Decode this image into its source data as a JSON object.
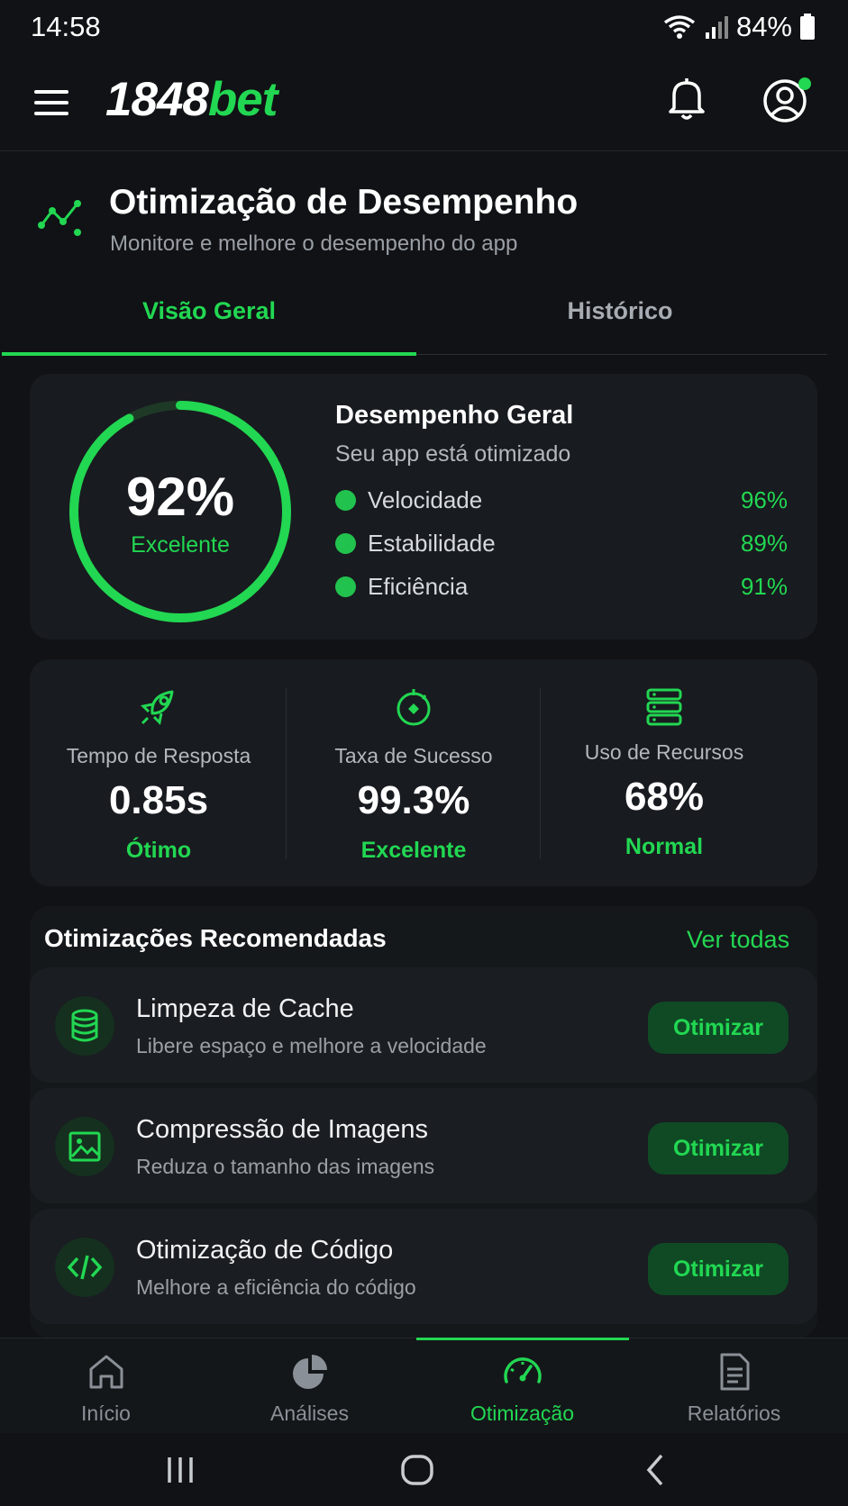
{
  "status_bar": {
    "time": "14:58",
    "battery": "84%"
  },
  "header": {
    "logo_number": "1848",
    "logo_word": "bet"
  },
  "page": {
    "title": "Otimização de Desempenho",
    "subtitle": "Monitore e melhore o desempenho do app"
  },
  "tabs": [
    {
      "label": "Visão Geral",
      "active": true
    },
    {
      "label": "Histórico",
      "active": false
    }
  ],
  "overall": {
    "score": "92%",
    "score_fraction": 0.92,
    "score_label": "Excelente",
    "title": "Desempenho Geral",
    "subtitle": "Seu app está otimizado",
    "metrics": [
      {
        "name": "Velocidade",
        "value": "96%"
      },
      {
        "name": "Estabilidade",
        "value": "89%"
      },
      {
        "name": "Eficiência",
        "value": "91%"
      }
    ]
  },
  "stats": [
    {
      "icon": "rocket-icon",
      "label": "Tempo de Resposta",
      "value": "0.85s",
      "status": "Ótimo"
    },
    {
      "icon": "target-icon",
      "label": "Taxa de Sucesso",
      "value": "99.3%",
      "status": "Excelente"
    },
    {
      "icon": "server-icon",
      "label": "Uso de Recursos",
      "value": "68%",
      "status": "Normal"
    }
  ],
  "recommendations": {
    "title": "Otimizações Recomendadas",
    "see_all": "Ver todas",
    "items": [
      {
        "icon": "database-icon",
        "name": "Limpeza de Cache",
        "description": "Libere espaço e melhore a velocidade",
        "action": "Otimizar"
      },
      {
        "icon": "image-icon",
        "name": "Compressão de Imagens",
        "description": "Reduza o tamanho das imagens",
        "action": "Otimizar"
      },
      {
        "icon": "code-icon",
        "name": "Otimização de Código",
        "description": "Melhore a eficiência do código",
        "action": "Otimizar"
      }
    ]
  },
  "bottom_nav": [
    {
      "icon": "home-icon",
      "label": "Início",
      "active": false
    },
    {
      "icon": "pie-chart-icon",
      "label": "Análises",
      "active": false
    },
    {
      "icon": "speedometer-icon",
      "label": "Otimização",
      "active": true
    },
    {
      "icon": "document-icon",
      "label": "Relatórios",
      "active": false
    }
  ],
  "colors": {
    "accent": "#22d752",
    "background": "#101215",
    "card": "#181b1f"
  }
}
